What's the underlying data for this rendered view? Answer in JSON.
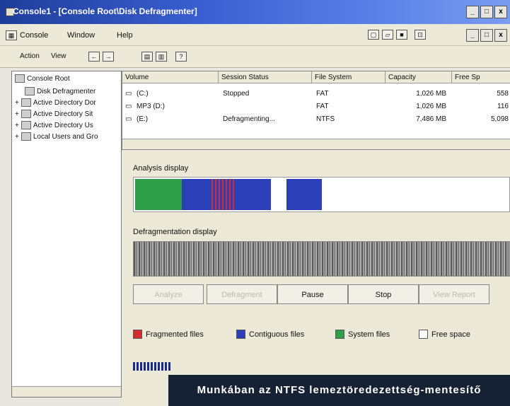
{
  "window": {
    "title": "Console1 - [Console Root\\Disk Defragmenter]",
    "controls": [
      "_",
      "□",
      "x"
    ]
  },
  "menu": {
    "items": [
      "Console",
      "Window",
      "Help"
    ]
  },
  "action_bar": {
    "items": [
      "Action",
      "View"
    ]
  },
  "tree": {
    "items": [
      "Console Root",
      "Disk Defragmenter",
      "Active Directory Dor",
      "Active Directory Sit",
      "Active Directory Us",
      "Local Users and Gro"
    ]
  },
  "volumes": {
    "columns": [
      "Volume",
      "Session Status",
      "File System",
      "Capacity",
      "Free Sp"
    ],
    "rows": [
      {
        "volume": "(C:)",
        "status": "Stopped",
        "fs": "FAT",
        "capacity": "1,026 MB",
        "free": "558"
      },
      {
        "volume": "MP3 (D:)",
        "status": "",
        "fs": "FAT",
        "capacity": "1,026 MB",
        "free": "116"
      },
      {
        "volume": "(E:)",
        "status": "Defragmenting...",
        "fs": "NTFS",
        "capacity": "7,486 MB",
        "free": "5,098"
      }
    ]
  },
  "analysis": {
    "label": "Analysis display"
  },
  "defragmentation": {
    "label": "Defragmentation display"
  },
  "buttons": {
    "analyze": "Analyze",
    "defragment": "Defragment",
    "pause": "Pause",
    "stop": "Stop",
    "view_report": "View Report"
  },
  "legend": {
    "items": [
      {
        "label": "Fragmented files",
        "color": "#d22c2c"
      },
      {
        "label": "Contiguous files",
        "color": "#2a3fb8"
      },
      {
        "label": "System files",
        "color": "#2f9e4a"
      },
      {
        "label": "Free space",
        "color": "#ffffff"
      }
    ]
  },
  "caption": {
    "text": "Munkában az NTFS lemeztöredezettség-mentesítő"
  }
}
